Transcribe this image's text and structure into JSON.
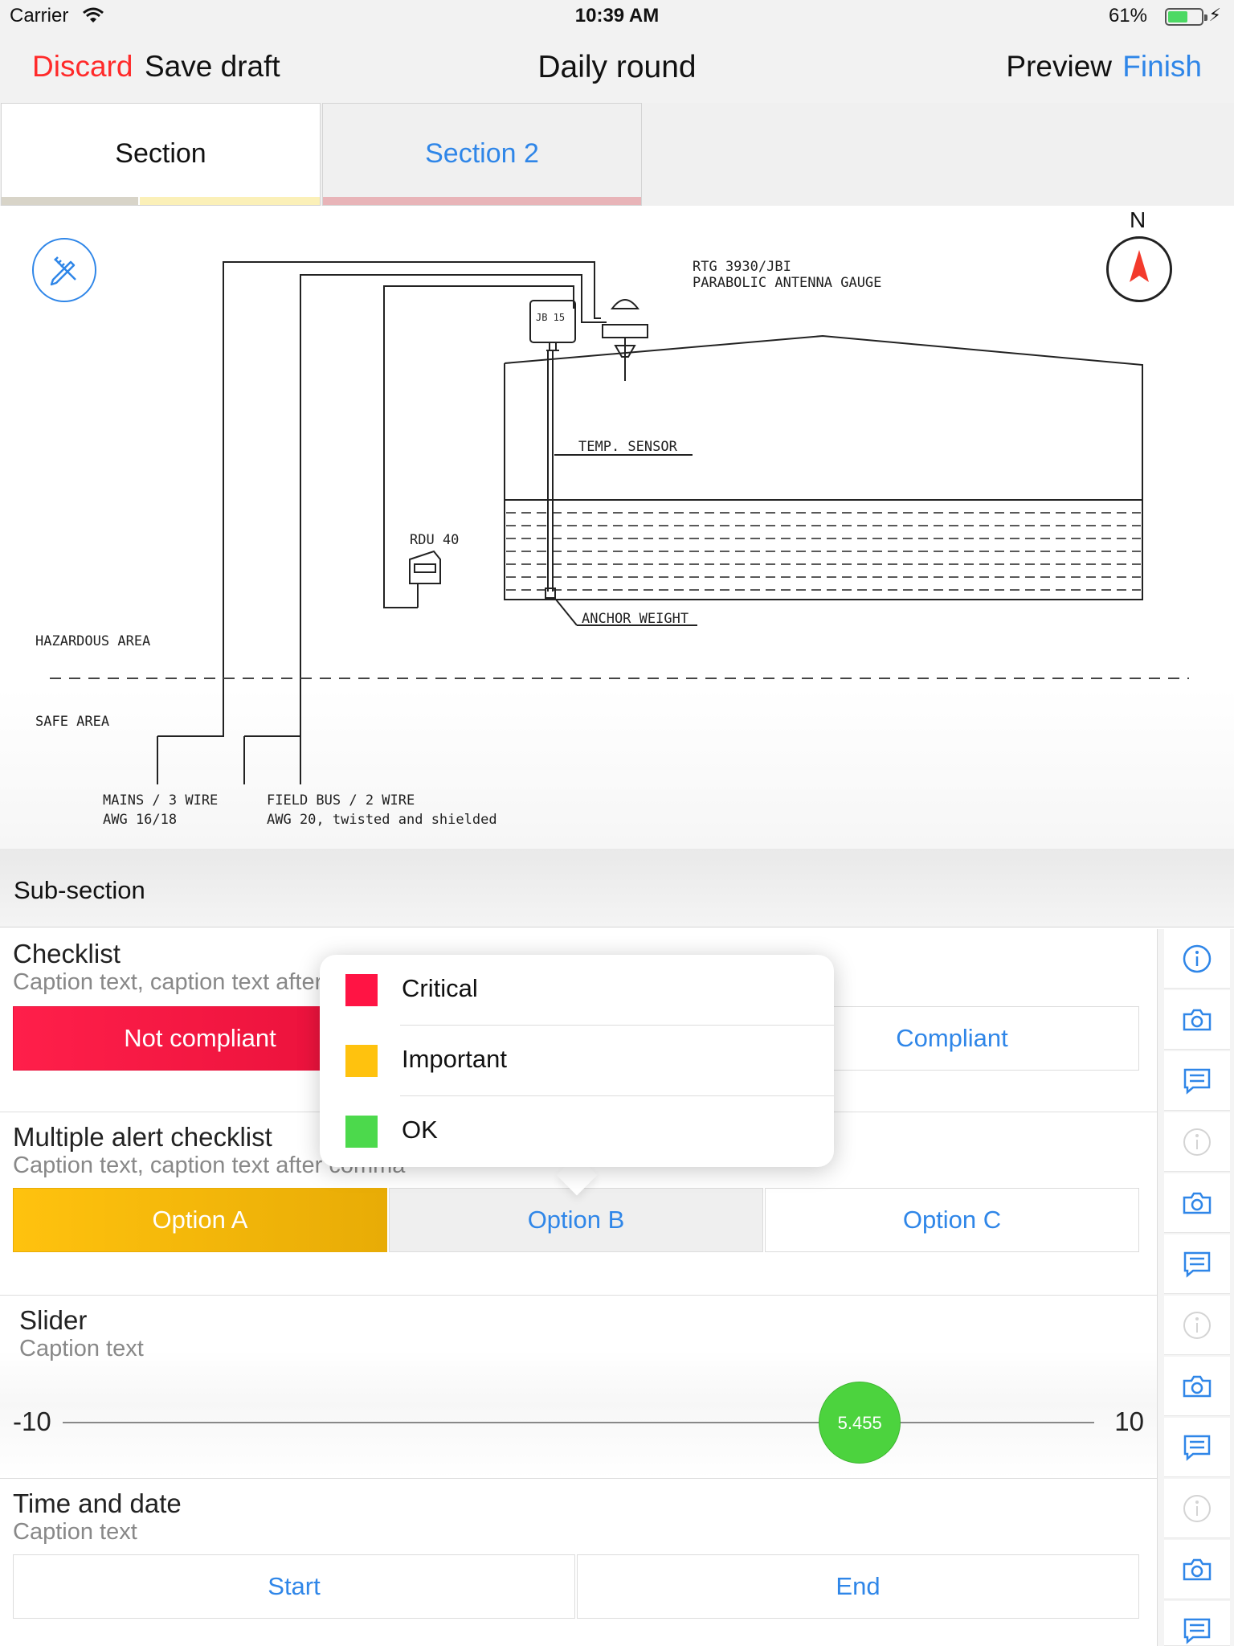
{
  "status_bar": {
    "carrier": "Carrier",
    "time": "10:39 AM",
    "battery_percent": "61%",
    "battery_level": 0.61,
    "charging_icon": "bolt-icon"
  },
  "nav": {
    "discard": "Discard",
    "save_draft": "Save draft",
    "title": "Daily round",
    "preview": "Preview",
    "finish": "Finish",
    "colors": {
      "destructive": "#ff2a2a",
      "accent": "#2f86e8"
    }
  },
  "tabs": [
    {
      "label": "Section",
      "selected": true,
      "stripe_colors": [
        "#d8d4c8",
        "#fbf0b8"
      ]
    },
    {
      "label": "Section 2",
      "selected": false,
      "stripe_colors": [
        "#e8b4b8"
      ]
    }
  ],
  "drawing": {
    "compass_label": "N",
    "labels": {
      "gauge_line1": "RTG 3930/JBI",
      "gauge_line2": "PARABOLIC ANTENNA GAUGE",
      "jb": "JB 15",
      "temp_sensor": "TEMP. SENSOR",
      "rdu": "RDU 40",
      "anchor": "ANCHOR WEIGHT",
      "hazardous": "HAZARDOUS AREA",
      "safe": "SAFE AREA",
      "mains_line1": "MAINS / 3 WIRE",
      "mains_line2": "AWG 16/18",
      "fieldbus_line1": "FIELD BUS / 2 WIRE",
      "fieldbus_line2": "AWG 20, twisted and shielded"
    }
  },
  "subsection": {
    "title": "Sub-section"
  },
  "form": {
    "checklist": {
      "title": "Checklist",
      "caption": "Caption text, caption text after comma",
      "options": [
        "Not compliant",
        "Compliant"
      ],
      "selected": "Not compliant"
    },
    "multi_alert": {
      "title": "Multiple alert checklist",
      "caption": "Caption text, caption text after comma",
      "options": [
        "Option A",
        "Option B",
        "Option C"
      ],
      "selected": "Option A"
    },
    "slider": {
      "title": "Slider",
      "caption": "Caption text",
      "min_label": "-10",
      "max_label": "10",
      "min": -10,
      "max": 10,
      "value": 5.455,
      "value_label": "5.455"
    },
    "time_date": {
      "title": "Time and date",
      "caption": "Caption text",
      "start": "Start",
      "end": "End"
    }
  },
  "side_actions": [
    "info-icon",
    "camera-icon",
    "comment-icon"
  ],
  "popover": {
    "items": [
      {
        "label": "Critical",
        "color": "#ff1444"
      },
      {
        "label": "Important",
        "color": "#ffc20e"
      },
      {
        "label": "OK",
        "color": "#4cd94c"
      }
    ]
  }
}
